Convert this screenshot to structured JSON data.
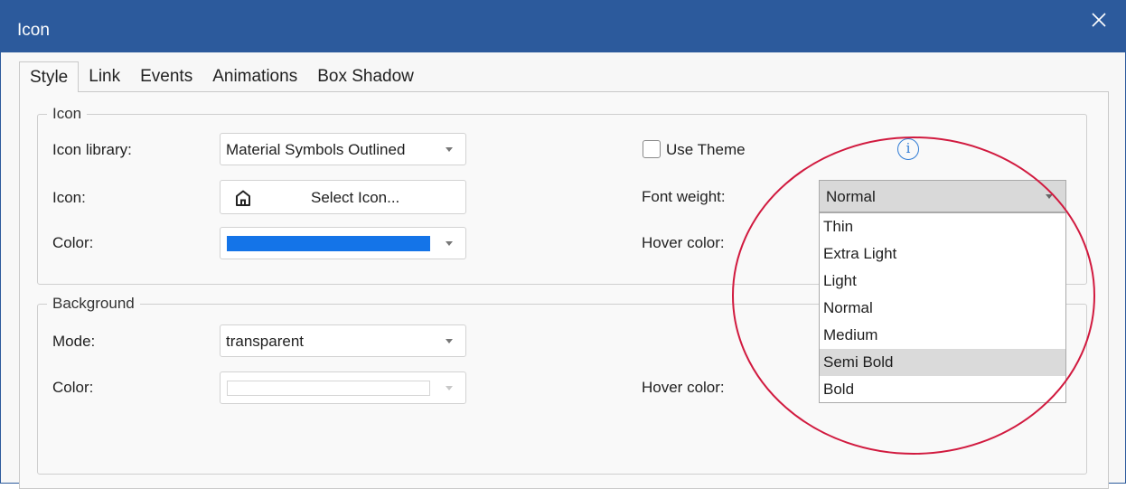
{
  "window": {
    "title": "Icon"
  },
  "tabs": [
    "Style",
    "Link",
    "Events",
    "Animations",
    "Box Shadow"
  ],
  "icon_group": {
    "legend": "Icon",
    "library_label": "Icon library:",
    "library_value": "Material Symbols Outlined",
    "icon_label": "Icon:",
    "select_icon_label": "Select Icon...",
    "color_label": "Color:",
    "color_value": "#1474e8",
    "use_theme_label": "Use Theme",
    "info_glyph": "i",
    "font_weight_label": "Font weight:",
    "font_weight_value": "Normal",
    "hover_color_label": "Hover color:"
  },
  "font_weight_options": [
    "Thin",
    "Extra Light",
    "Light",
    "Normal",
    "Medium",
    "Semi Bold",
    "Bold"
  ],
  "font_weight_highlighted": "Semi Bold",
  "background_group": {
    "legend": "Background",
    "mode_label": "Mode:",
    "mode_value": "transparent",
    "color_label": "Color:",
    "hover_color_label": "Hover color:"
  },
  "colors": {
    "titlebar": "#2c5a9c",
    "annotation_circle": "#d11a3f",
    "info_accent": "#2f7bd4"
  },
  "icons": {
    "close": "close-icon",
    "home": "home-icon",
    "info": "info-icon"
  }
}
